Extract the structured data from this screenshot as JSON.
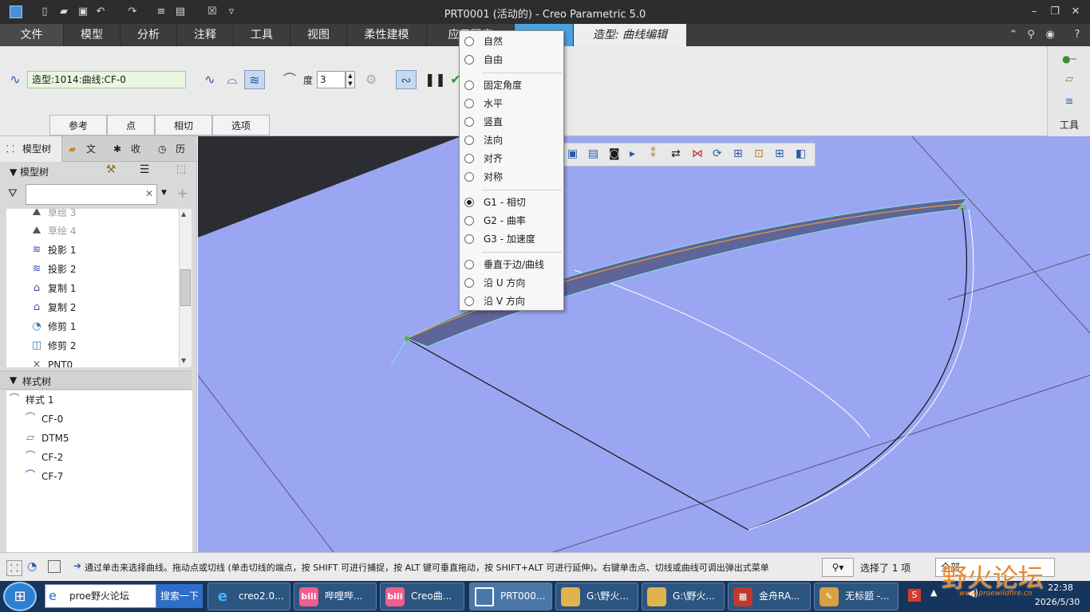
{
  "window": {
    "title": "PRT0001 (活动的) - Creo Parametric 5.0",
    "quick_access": [
      "new-icon",
      "open-icon",
      "save-icon",
      "undo-icon",
      "redo-icon",
      "regenerate-icon",
      "windows-icon",
      "close-window-icon",
      "customize-icon"
    ],
    "controls": [
      "minimize-icon",
      "restore-icon",
      "close-icon"
    ]
  },
  "menu": {
    "tabs": [
      "文件",
      "模型",
      "分析",
      "注释",
      "工具",
      "视图",
      "柔性建模",
      "应用程序"
    ],
    "style_tab": "造型: 曲线编辑"
  },
  "ribbon": {
    "selection_value": "造型:1014:曲线:CF-0",
    "degree_label": "度",
    "degree_value": "3",
    "subtabs": [
      "参考",
      "点",
      "相切",
      "选项"
    ],
    "tools_label": "工具"
  },
  "popup": {
    "items": [
      {
        "label": "自然",
        "selected": false
      },
      {
        "label": "自由",
        "selected": false
      },
      {
        "label": "固定角度",
        "selected": false
      },
      {
        "label": "水平",
        "selected": false
      },
      {
        "label": "竖直",
        "selected": false
      },
      {
        "label": "法向",
        "selected": false
      },
      {
        "label": "对齐",
        "selected": false
      },
      {
        "label": "对称",
        "selected": false
      },
      {
        "label": "G1 - 相切",
        "selected": true
      },
      {
        "label": "G2 - 曲率",
        "selected": false
      },
      {
        "label": "G3 - 加速度",
        "selected": false
      },
      {
        "label": "垂直于边/曲线",
        "selected": false
      },
      {
        "label": "沿 U 方向",
        "selected": false
      },
      {
        "label": "沿 V 方向",
        "selected": false
      }
    ]
  },
  "left_panel": {
    "tabs": [
      "模型树",
      "文",
      "收",
      "历"
    ],
    "model_tree_header": "模型树",
    "tree_items": [
      "草绘 3",
      "草绘 4",
      "投影 1",
      "投影 2",
      "复制 1",
      "复制 2",
      "修剪 1",
      "修剪 2",
      "PNT0"
    ],
    "style_tree_header": "样式树",
    "style_items": [
      "样式 1",
      "CF-0",
      "DTM5",
      "CF-2",
      "CF-7"
    ]
  },
  "status": {
    "message": "通过单击来选择曲线。拖动点或切线 (单击切线的端点，按 SHIFT 可进行捕捉，按 ALT 键可垂直拖动，按 SHIFT+ALT 可进行延伸)。右键单击点、切线或曲线可调出弹出式菜单",
    "selection_count": "选择了 1 项",
    "filter": "全部"
  },
  "taskbar": {
    "search_text": "proe野火论坛",
    "search_button": "搜索一下",
    "tasks": [
      "creo2.0...",
      "哔哩哔...",
      "Creo曲...",
      "PRT000...",
      "G:\\野火...",
      "G:\\野火...",
      "金舟RA...",
      "无标题 -..."
    ],
    "time": "22:38",
    "date": "2026/5/30"
  },
  "watermark": {
    "text": "野火论坛",
    "url": "www.proewildfire.cn"
  }
}
